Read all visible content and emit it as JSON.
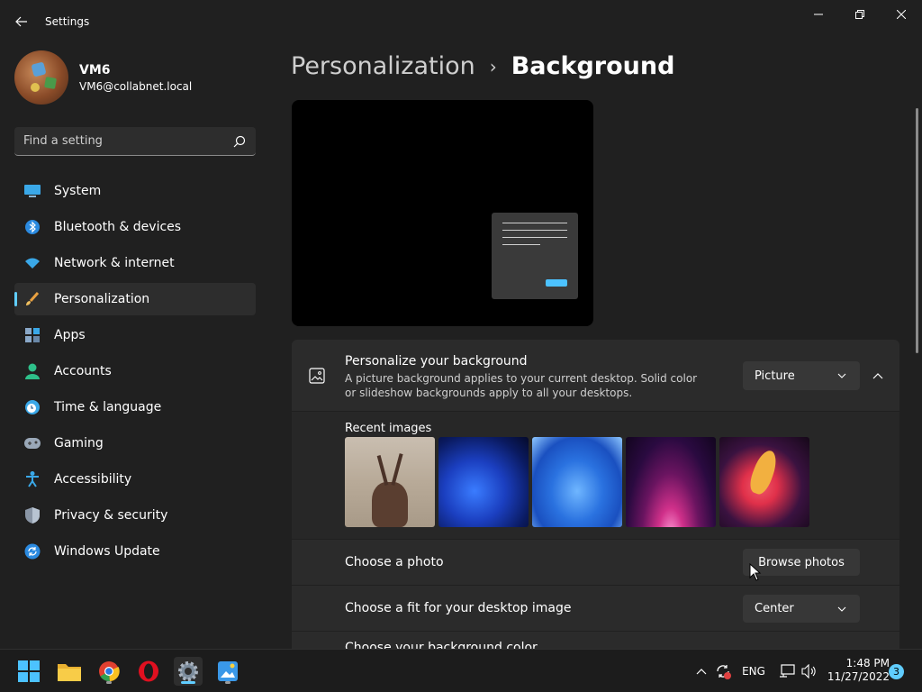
{
  "window": {
    "title": "Settings"
  },
  "profile": {
    "name": "VM6",
    "email": "VM6@collabnet.local"
  },
  "search": {
    "placeholder": "Find a setting"
  },
  "sidebar": {
    "items": [
      {
        "label": "System",
        "icon": "monitor-icon",
        "active": false
      },
      {
        "label": "Bluetooth & devices",
        "icon": "bluetooth-icon",
        "active": false
      },
      {
        "label": "Network & internet",
        "icon": "wifi-icon",
        "active": false
      },
      {
        "label": "Personalization",
        "icon": "paintbrush-icon",
        "active": true
      },
      {
        "label": "Apps",
        "icon": "apps-icon",
        "active": false
      },
      {
        "label": "Accounts",
        "icon": "person-icon",
        "active": false
      },
      {
        "label": "Time & language",
        "icon": "clock-globe-icon",
        "active": false
      },
      {
        "label": "Gaming",
        "icon": "gamepad-icon",
        "active": false
      },
      {
        "label": "Accessibility",
        "icon": "accessibility-icon",
        "active": false
      },
      {
        "label": "Privacy & security",
        "icon": "shield-icon",
        "active": false
      },
      {
        "label": "Windows Update",
        "icon": "update-icon",
        "active": false
      }
    ]
  },
  "breadcrumb": {
    "parent": "Personalization",
    "separator": "›",
    "current": "Background"
  },
  "background_section": {
    "title": "Personalize your background",
    "description": "A picture background applies to your current desktop. Solid color or slideshow backgrounds apply to all your desktops.",
    "selected_type": "Picture",
    "recent_label": "Recent images",
    "recent_images": [
      "deer-photo",
      "blue-bloom-dark",
      "blue-bloom-light",
      "purple-glow",
      "flower-abstract"
    ],
    "choose_photo_label": "Choose a photo",
    "browse_label": "Browse photos",
    "fit_label": "Choose a fit for your desktop image",
    "fit_value": "Center",
    "color_label": "Choose your background color"
  },
  "taskbar": {
    "apps": [
      "start-icon",
      "file-explorer-icon",
      "chrome-icon",
      "opera-icon",
      "settings-icon",
      "paint-icon"
    ],
    "language": "ENG",
    "time": "1:48 PM",
    "date": "11/27/2022",
    "notification_count": "3"
  },
  "colors": {
    "accent": "#60cdff",
    "background": "#202020",
    "card": "#2b2b2b"
  }
}
